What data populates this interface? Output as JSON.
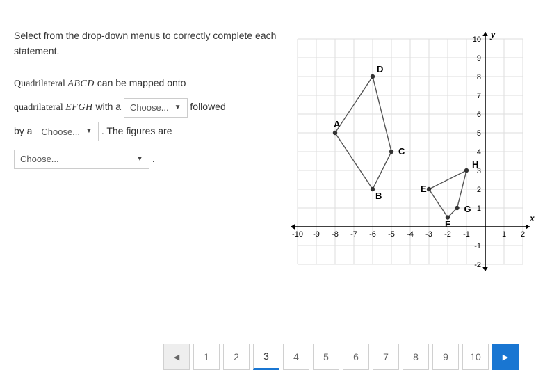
{
  "question": {
    "intro": "Select from the drop-down menus to correctly complete each statement.",
    "line1_prefix": "Quadrilateral ",
    "quad1": "ABCD",
    "line1_suffix": " can be mapped onto",
    "line2_prefix": "quadrilateral ",
    "quad2": "EFGH",
    "line2_mid": " with a ",
    "line2_suffix": " followed",
    "line3_prefix": "by a ",
    "line3_suffix": ". The figures are",
    "period": "."
  },
  "dropdowns": {
    "d1": "Choose...",
    "d2": "Choose...",
    "d3": "Choose..."
  },
  "chart_data": {
    "type": "scatter",
    "title": "",
    "xlabel": "x",
    "ylabel": "y",
    "xlim": [
      -10,
      2
    ],
    "ylim": [
      -2,
      10
    ],
    "grid": true,
    "xticks": [
      -10,
      -9,
      -8,
      -7,
      -6,
      -5,
      -4,
      -3,
      -2,
      -1,
      1,
      2
    ],
    "yticks": [
      -2,
      -1,
      1,
      2,
      3,
      4,
      5,
      6,
      7,
      8,
      9,
      10
    ],
    "series": [
      {
        "name": "ABCD",
        "type": "polygon",
        "points": [
          {
            "label": "A",
            "x": -8,
            "y": 5
          },
          {
            "label": "B",
            "x": -6,
            "y": 2
          },
          {
            "label": "C",
            "x": -5,
            "y": 4
          },
          {
            "label": "D",
            "x": -6,
            "y": 8
          }
        ]
      },
      {
        "name": "EFGH",
        "type": "polygon",
        "points": [
          {
            "label": "E",
            "x": -3,
            "y": 2
          },
          {
            "label": "F",
            "x": -2,
            "y": 0.5
          },
          {
            "label": "G",
            "x": -1.5,
            "y": 1
          },
          {
            "label": "H",
            "x": -1,
            "y": 3
          }
        ]
      }
    ]
  },
  "pager": {
    "pages": [
      "1",
      "2",
      "3",
      "4",
      "5",
      "6",
      "7",
      "8",
      "9",
      "10"
    ],
    "active": 3
  }
}
